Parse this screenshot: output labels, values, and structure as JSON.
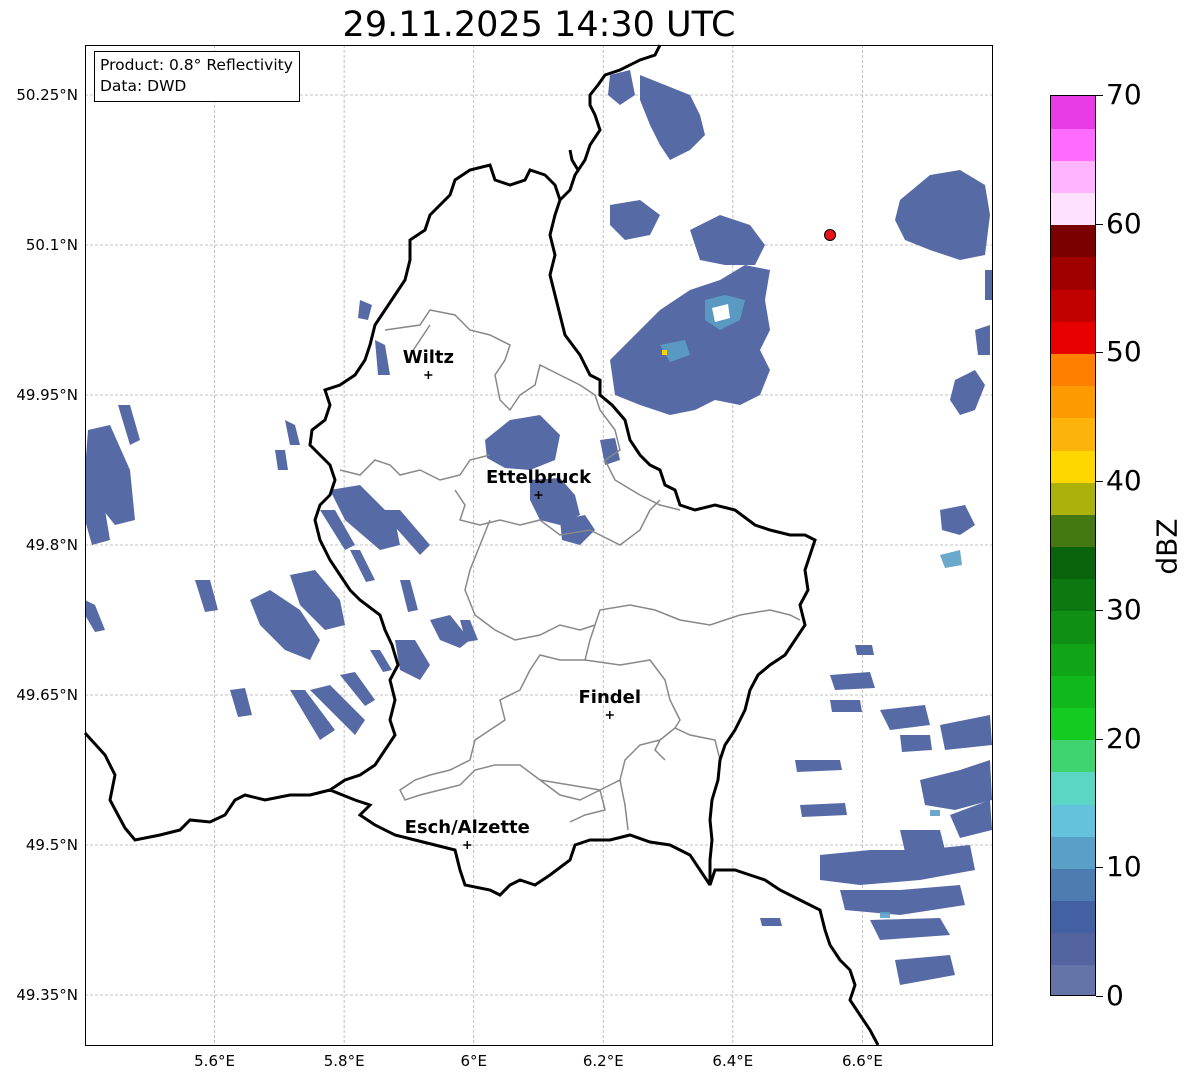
{
  "title": "29.11.2025 14:30 UTC",
  "info": {
    "line1": "Product: 0.8° Reflectivity",
    "line2": "Data: DWD"
  },
  "map": {
    "lon_range": [
      5.4,
      6.8
    ],
    "lat_range": [
      49.3,
      50.3
    ],
    "lat_ticks": [
      "50.25°N",
      "50.1°N",
      "49.95°N",
      "49.8°N",
      "49.65°N",
      "49.5°N",
      "49.35°N"
    ],
    "lon_ticks": [
      "5.6°E",
      "5.8°E",
      "6°E",
      "6.2°E",
      "6.4°E",
      "6.6°E"
    ],
    "radar_site": {
      "lon": 6.55,
      "lat": 50.11,
      "color": "#e8141c"
    },
    "cities": [
      {
        "name": "Wiltz",
        "lon": 5.93,
        "lat": 49.97
      },
      {
        "name": "Ettelbruck",
        "lon": 6.1,
        "lat": 49.85
      },
      {
        "name": "Findel",
        "lon": 6.21,
        "lat": 49.63
      },
      {
        "name": "Esch/Alzette",
        "lon": 5.99,
        "lat": 49.5
      }
    ]
  },
  "colorbar": {
    "label": "dBZ",
    "tick_labels": [
      "0",
      "10",
      "20",
      "30",
      "40",
      "50",
      "60",
      "70"
    ],
    "colors": [
      "#6574a8",
      "#5464a0",
      "#4360a3",
      "#4d7cb3",
      "#5a9fc6",
      "#65c2dd",
      "#5cd6c4",
      "#3fd46f",
      "#14cb22",
      "#11b81c",
      "#10a517",
      "#0f8f13",
      "#0c7910",
      "#0a640c",
      "#437812",
      "#adb20a",
      "#ffd700",
      "#fcb40a",
      "#fd9a00",
      "#ff7f00",
      "#e60000",
      "#c30000",
      "#a00000",
      "#7a0000",
      "#ffe0ff",
      "#ffb4ff",
      "#ff6bff",
      "#e83be8"
    ]
  }
}
